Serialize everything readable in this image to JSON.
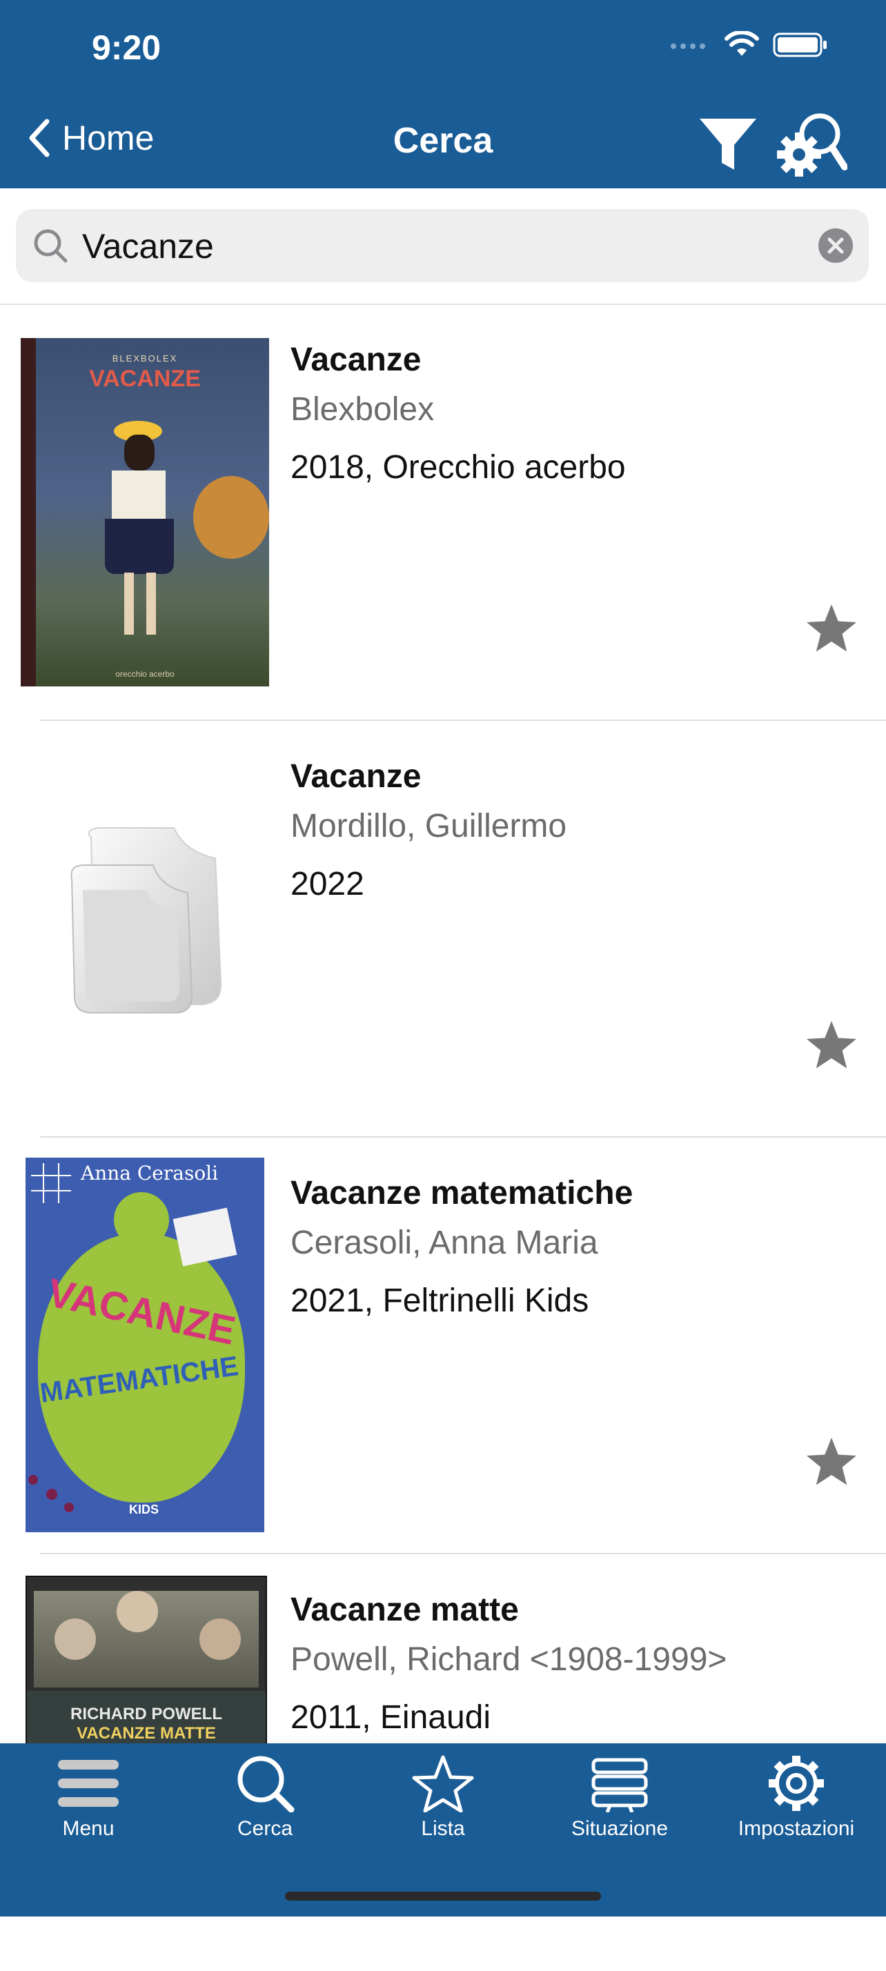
{
  "status": {
    "time": "9:20"
  },
  "nav": {
    "back_label": "Home",
    "title": "Cerca"
  },
  "search": {
    "value": "Vacanze"
  },
  "results": [
    {
      "title": "Vacanze",
      "author": "Blexbolex",
      "publication": "2018, Orecchio acerbo",
      "cover_text": "VACANZE",
      "cover_top_text": "BLEXBOLEX",
      "cover_bottom_text": "orecchio acerbo"
    },
    {
      "title": "Vacanze",
      "author": "Mordillo, Guillermo",
      "publication": "2022"
    },
    {
      "title": "Vacanze matematiche",
      "author": "Cerasoli, Anna Maria",
      "publication": "2021, Feltrinelli Kids",
      "cover_author": "Anna Cerasoli",
      "cover_title_1": "VACANZE",
      "cover_title_2": "MATEMATICHE",
      "cover_publisher": "KIDS"
    },
    {
      "title": "Vacanze matte",
      "author": "Powell, Richard  <1908-1999>",
      "publication": "2011, Einaudi",
      "cover_author": "RICHARD POWELL",
      "cover_title": "VACANZE MATTE"
    }
  ],
  "tabs": [
    {
      "label": "Menu",
      "icon": "menu-icon"
    },
    {
      "label": "Cerca",
      "icon": "search-icon"
    },
    {
      "label": "Lista",
      "icon": "star-icon"
    },
    {
      "label": "Situazione",
      "icon": "books-icon"
    },
    {
      "label": "Impostazioni",
      "icon": "gear-icon"
    }
  ],
  "colors": {
    "header": "#1a5c96",
    "star": "#777777"
  }
}
